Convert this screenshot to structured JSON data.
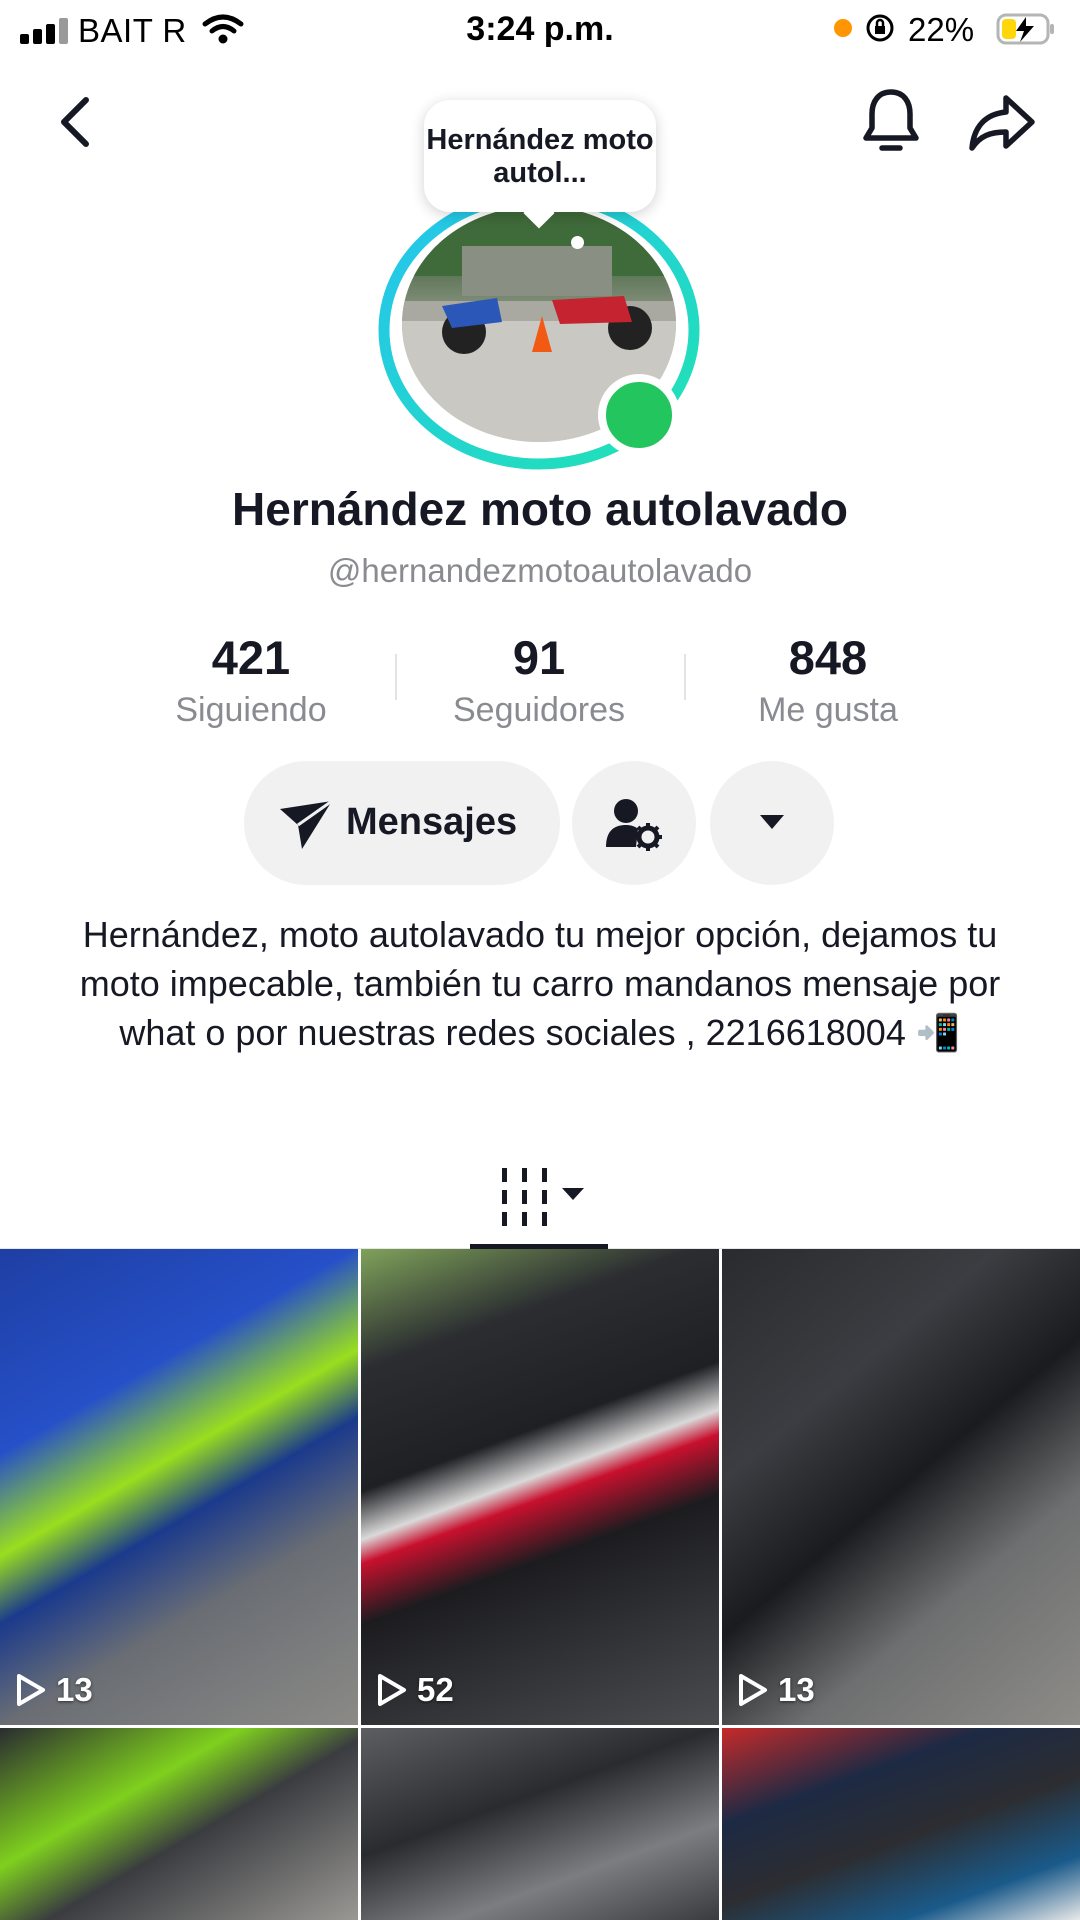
{
  "status_bar": {
    "carrier": "BAIT R",
    "time": "3:24 p.m.",
    "battery": "22%"
  },
  "header": {
    "back_icon": "chevron-left-icon",
    "bell_icon": "bell-icon",
    "share_icon": "share-arrow-icon"
  },
  "profile": {
    "bubble_text": "Hernández moto autol...",
    "name": "Hernández moto autolavado",
    "username": "@hernandezmotoautolavado",
    "online_color": "#22c55e",
    "ring_colors": [
      "#25c4ef",
      "#20e3b2"
    ]
  },
  "stats": [
    {
      "value": "421",
      "label": "Siguiendo"
    },
    {
      "value": "91",
      "label": "Seguidores"
    },
    {
      "value": "848",
      "label": "Me gusta"
    }
  ],
  "actions": {
    "message_label": "Mensajes",
    "message_icon": "send-icon",
    "friends_icon": "user-settings-icon",
    "more_icon": "caret-down-icon"
  },
  "bio": "Hernández, moto autolavado  tu mejor opción, dejamos tu moto impecable, también tu carro mandanos mensaje por what o por nuestras redes sociales , 2216618004 📲",
  "tabs": {
    "active_icon": "grid-icon"
  },
  "videos": [
    {
      "views": "13"
    },
    {
      "views": "52"
    },
    {
      "views": "13"
    },
    {
      "views": ""
    },
    {
      "views": ""
    },
    {
      "views": ""
    }
  ]
}
